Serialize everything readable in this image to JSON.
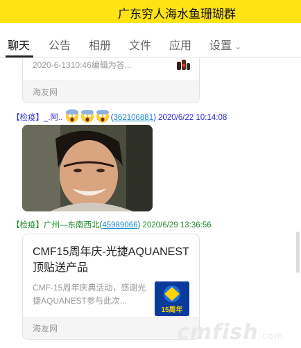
{
  "header": {
    "title": "广东穷人海水鱼珊瑚群"
  },
  "tabs": [
    {
      "label": "聊天"
    },
    {
      "label": "公告"
    },
    {
      "label": "相册"
    },
    {
      "label": "文件"
    },
    {
      "label": "应用"
    },
    {
      "label": "设置"
    }
  ],
  "messages": {
    "card1": {
      "desc": "2020-6-1310:46编辑为答...",
      "footer": "海友网"
    },
    "msg1": {
      "tag": "【检疫】",
      "name": "_.阿..",
      "qq": "362106881",
      "time": "2020/6/22 10:14:08",
      "emoji": "scream-emoji"
    },
    "msg2": {
      "tag": "【检疫】",
      "name": "广州—东南西北",
      "qq": "45989066",
      "time": "2020/6/29 13:36:56"
    },
    "card2": {
      "title": "CMF15周年庆-光捷AQUANEST顶贴送产品",
      "desc": "CMF-15周年庆典活动，感谢光捷AQUANEST参与此次...",
      "thumb_label": "15周年",
      "footer": "海友网"
    }
  },
  "watermark": {
    "text": "cmfish",
    "suffix": ".com"
  },
  "colors": {
    "titlebar": "#ffe313",
    "tag": "#2b2bd6",
    "name2": "#1a8a2a",
    "link": "#1a8ad6"
  }
}
